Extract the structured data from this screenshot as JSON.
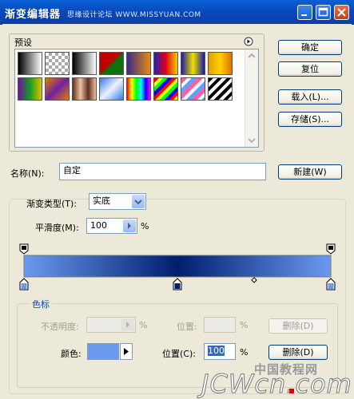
{
  "window": {
    "title": "渐变编辑器",
    "watermark": "思缘设计论坛 WWW.MISSYUAN.COM",
    "icons": [
      "minimize-icon",
      "maximize-icon",
      "close-icon"
    ]
  },
  "presets": {
    "label": "预设",
    "menu_icon": "arrow-right-circle-icon",
    "swatches": [
      "linear-gradient(to right,#000,#fff)",
      "repeating-conic-gradient(#aaa 0 25%,#fff 0 50%) 0 0/8px 8px",
      "linear-gradient(to right,#000,#fff)",
      "linear-gradient(135deg,#c00000 0%,#c00000 45%,#107010 55%,#107010 100%)",
      "linear-gradient(to right,#3a2a8a,#e88a10)",
      "linear-gradient(to right,#2020c0,#e00010,#f0d000)",
      "linear-gradient(to right,#1a1aa0,#f0e000,#1a1aa0)",
      "linear-gradient(to right,#e0a000,#ffd000,#e07000)",
      "linear-gradient(to right,#7010a0,#10a020,#e0c000)",
      "linear-gradient(135deg,#e08000 0%,#7020a0 50%,#e08000 100%)",
      "linear-gradient(to right,#603020,#f0c0a0,#603020,#f0c0a0)",
      "linear-gradient(135deg,#3080e0,#f0f0ff 50%,#3080e0)",
      "linear-gradient(to right,#ff0000,#ffff00,#00ff00,#00ffff,#0000ff,#ff00ff)",
      "repeating-linear-gradient(135deg,#ff0000 0 4px,#ffff00 4px 8px,#00ff00 8px 12px,#0000ff 12px 16px)",
      "repeating-linear-gradient(135deg,#ff60a0 0 5px,#ffffff 5px 9px,#60a0ff 9px 14px)",
      "repeating-linear-gradient(135deg,#000 0 4px,#fff 4px 8px)"
    ]
  },
  "buttons": {
    "ok": "确定",
    "reset": "复位",
    "load": "载入(L)...",
    "save": "存储(S)...",
    "new": "新建(W)"
  },
  "name_field": {
    "label": "名称(N):",
    "value": "自定"
  },
  "gradient": {
    "type_label": "渐变类型(T):",
    "type_value": "实底",
    "smoothness_label": "平滑度(M):",
    "smoothness_value": "100",
    "smoothness_unit": "%",
    "colors": {
      "start": "#6a9af0",
      "mid": "#001e6e",
      "end": "#6a9af0"
    },
    "color_stop_positions": [
      0,
      0.5,
      1.0
    ],
    "midpoint_position": 0.75
  },
  "stops_group": {
    "legend": "色标",
    "opacity_label": "不透明度:",
    "opacity_unit": "%",
    "opacity_position_label": "位置:",
    "opacity_position_unit": "%",
    "opacity_delete": "删除(D)",
    "color_label": "颜色:",
    "color_swatch": "#6a9af0",
    "color_position_label": "位置(C):",
    "color_position_value": "100",
    "color_position_unit": "%",
    "color_delete": "删除(D)"
  },
  "site_watermark": "JCWcn.com",
  "site_watermark_cn": "中国教程网"
}
